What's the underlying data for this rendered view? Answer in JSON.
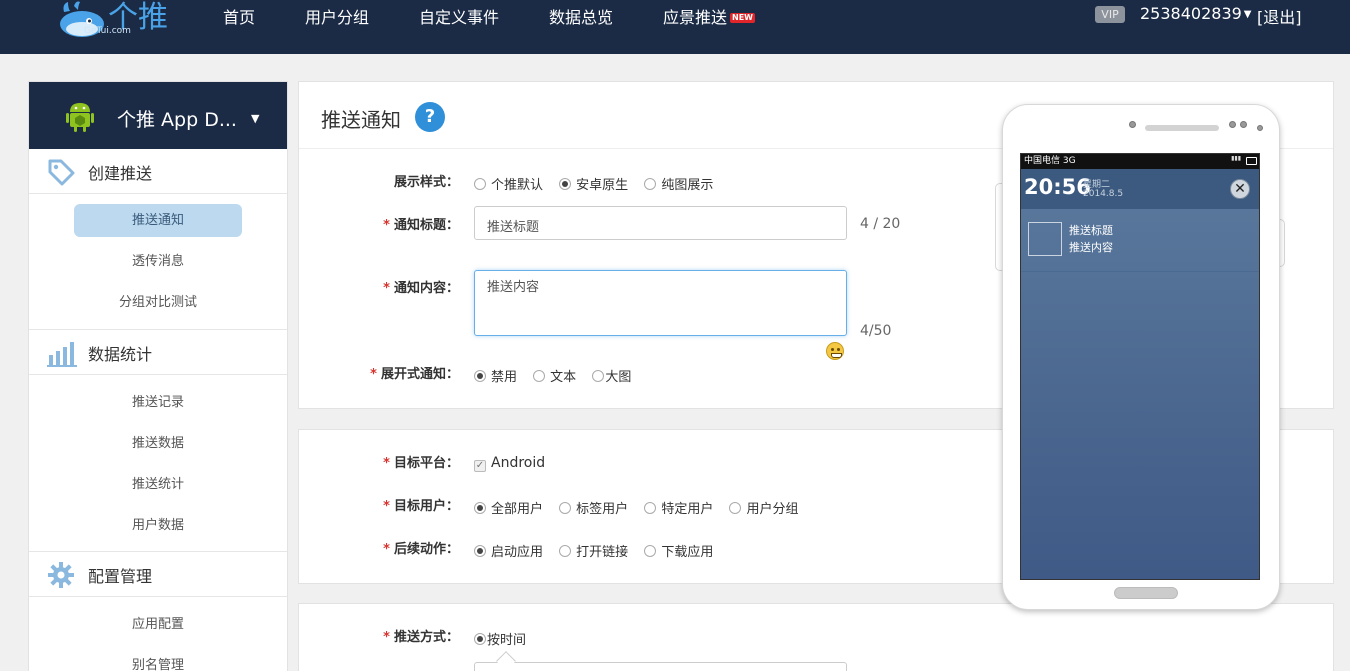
{
  "header": {
    "logo_text": "个推",
    "logo_sub": "GeTui.com",
    "nav": [
      "首页",
      "用户分组",
      "自定义事件",
      "数据总览",
      "应景推送"
    ],
    "new_badge": "NEW",
    "vip": "VIP",
    "account": "2538402839",
    "logout": "[退出]"
  },
  "sidebar": {
    "app_name": "个推 App D...",
    "sections": [
      {
        "title": "创建推送",
        "icon": "tag-icon",
        "items": [
          "推送通知",
          "透传消息",
          "分组对比测试"
        ]
      },
      {
        "title": "数据统计",
        "icon": "bar-chart-icon",
        "items": [
          "推送记录",
          "推送数据",
          "推送统计",
          "用户数据"
        ]
      },
      {
        "title": "配置管理",
        "icon": "gear-icon",
        "items": [
          "应用配置",
          "别名管理"
        ]
      }
    ],
    "active_item": "推送通知"
  },
  "form": {
    "title": "推送通知",
    "help": "?",
    "display_style": {
      "label": "展示样式：",
      "options": [
        "个推默认",
        "安卓原生",
        "纯图展示"
      ],
      "selected": 1
    },
    "notif_title": {
      "label": "通知标题：",
      "placeholder": "推送标题",
      "counter": "4 / 20"
    },
    "notif_content": {
      "label": "通知内容：",
      "value": "推送内容",
      "counter": "4/50"
    },
    "expand": {
      "label": "展开式通知：",
      "options": [
        "禁用",
        "文本",
        "大图"
      ],
      "selected": 0
    },
    "target_platform": {
      "label": "目标平台：",
      "value": "Android"
    },
    "target_users": {
      "label": "目标用户：",
      "options": [
        "全部用户",
        "标签用户",
        "特定用户",
        "用户分组"
      ],
      "selected": 0
    },
    "follow_action": {
      "label": "后续动作：",
      "options": [
        "启动应用",
        "打开链接",
        "下载应用"
      ],
      "selected": 0
    },
    "push_method": {
      "label": "推送方式：",
      "options": [
        "按时间"
      ],
      "selected": 0
    }
  },
  "phone": {
    "carrier": "中国电信 3G",
    "time": "20:56",
    "weekday": "星期二",
    "date": "2014.8.5",
    "notif_title": "推送标题",
    "notif_body": "推送内容"
  }
}
